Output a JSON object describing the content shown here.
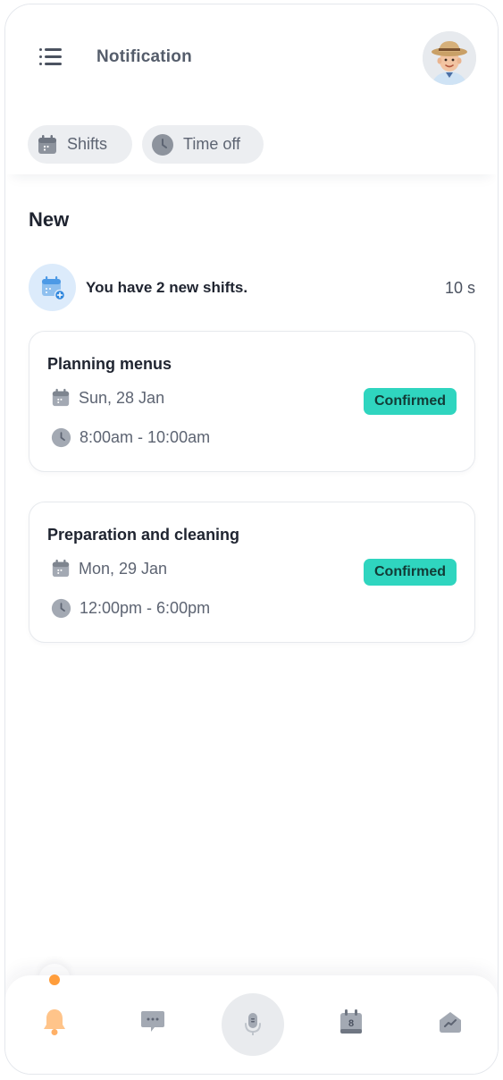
{
  "header": {
    "title": "Notification",
    "menu_icon": "hamburger-menu-icon",
    "avatar_icon": "user-avatar"
  },
  "filters": [
    {
      "label": "Shifts",
      "icon": "calendar-icon"
    },
    {
      "label": "Time off",
      "icon": "clock-icon"
    }
  ],
  "section": {
    "title": "New"
  },
  "notification": {
    "text": "You have 2 new shifts.",
    "time": "10 s",
    "icon": "calendar-add-icon"
  },
  "shifts": [
    {
      "title": "Planning menus",
      "date": "Sun, 28 Jan",
      "time": "8:00am - 10:00am",
      "status": "Confirmed"
    },
    {
      "title": "Preparation and cleaning",
      "date": "Mon, 29 Jan",
      "time": "12:00pm - 6:00pm",
      "status": "Confirmed"
    }
  ],
  "bottom_nav": [
    {
      "icon": "bell-icon",
      "active": true
    },
    {
      "icon": "chat-icon",
      "active": false
    },
    {
      "icon": "microphone-icon",
      "active": false
    },
    {
      "icon": "calendar-icon",
      "active": false,
      "badge_text": "8"
    },
    {
      "icon": "stats-icon",
      "active": false
    }
  ],
  "colors": {
    "accent_orange": "#ff9d3b",
    "confirmed_badge": "#2fd5bf",
    "notif_icon_bg": "#dcebfb",
    "icon_gray": "#a3a9b3"
  }
}
